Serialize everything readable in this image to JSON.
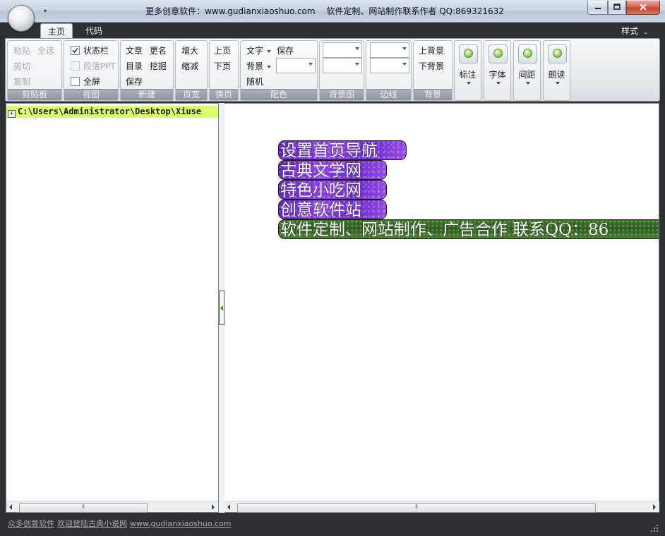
{
  "window": {
    "title_parts": [
      "更多创意软件：www.gudianxiaoshuo.com",
      "软件定制、网站制作联系作者 QQ:869321632"
    ]
  },
  "tabs": {
    "home": "主页",
    "code": "代码",
    "style_menu": "样式"
  },
  "ribbon": {
    "clipboard": {
      "paste": "粘贴",
      "select_all": "全选",
      "cut": "剪切",
      "copy": "复制",
      "label": "剪贴板"
    },
    "view": {
      "statusbar": "状态栏",
      "statusbar_checked": true,
      "paragraph_ppt": "段落PPT",
      "fullscreen": "全屏",
      "label": "视图"
    },
    "new": {
      "article": "文章",
      "rename": "更名",
      "toc": "目录",
      "dig": "挖掘",
      "save": "保存",
      "label": "新建"
    },
    "pagewidth": {
      "increase": "增大",
      "decrease": "缩减",
      "label": "页宽"
    },
    "pageturn": {
      "prev": "上页",
      "next": "下页",
      "label": "换页"
    },
    "colors": {
      "text": "文字",
      "save": "保存",
      "background": "背景",
      "random": "随机",
      "label": "配色"
    },
    "bgimage": {
      "label": "背景图"
    },
    "border": {
      "label": "边线"
    },
    "background": {
      "prev_bg": "上背景",
      "next_bg": "下背景",
      "label": "背景"
    },
    "big_buttons": {
      "annotate": "标注",
      "font": "字体",
      "spacing": "间距",
      "read_aloud": "朗读"
    }
  },
  "tree": {
    "path": "C:\\Users\\Administrator\\Desktop\\Xiuse"
  },
  "document": {
    "lines": [
      "设置首页导航",
      "古典文学网",
      "特色小吃网",
      "创意软件站",
      "软件定制、网站制作、广告合作 联系QQ：86"
    ]
  },
  "statusbar": {
    "parts": [
      "众多创意软件",
      "欢迎登陆古典小说网",
      "www.gudianxiaoshuo.com"
    ]
  },
  "scroll": {
    "left_thumb_symbol": "⦀",
    "right_thumb_symbol": "⦀"
  },
  "colors": {
    "tree_highlight": "#d9ff6e",
    "nav_purple": "#7b34d6",
    "banner_green": "#3a6a28",
    "chrome_dark": "#2f3034"
  }
}
